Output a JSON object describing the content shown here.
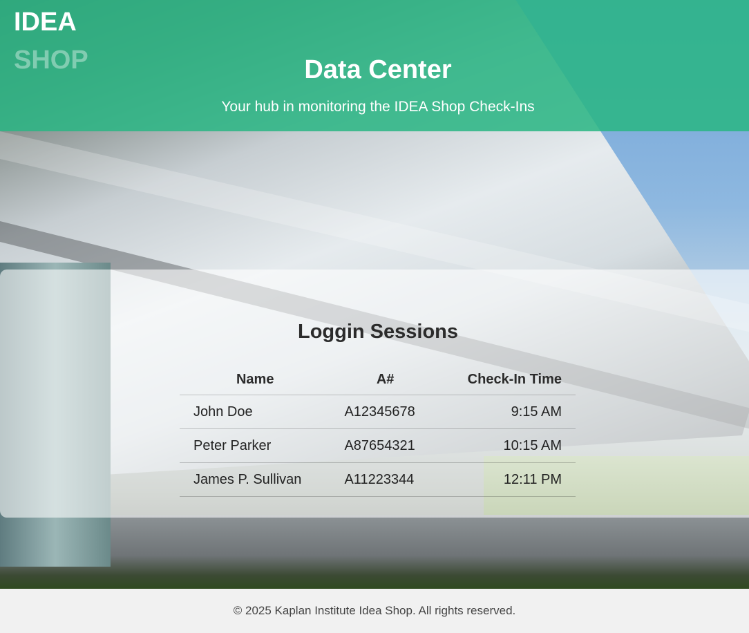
{
  "brand": {
    "line1": "IDEA",
    "line2": "SHOP"
  },
  "header": {
    "title": "Data Center",
    "subtitle": "Your hub in monitoring the IDEA Shop Check-Ins"
  },
  "sessions": {
    "title": "Loggin Sessions",
    "columns": [
      "Name",
      "A#",
      "Check-In Time"
    ],
    "rows": [
      {
        "name": "John Doe",
        "id": "A12345678",
        "time": "9:15 AM"
      },
      {
        "name": "Peter Parker",
        "id": "A87654321",
        "time": "10:15 AM"
      },
      {
        "name": "James P. Sullivan",
        "id": "A11223344",
        "time": "12:11 PM"
      }
    ]
  },
  "footer": {
    "text": "© 2025 Kaplan Institute Idea Shop. All rights reserved."
  },
  "colors": {
    "header": "#2ab684",
    "footer_bg": "#f1f1f1",
    "text": "#2b2b2b"
  }
}
